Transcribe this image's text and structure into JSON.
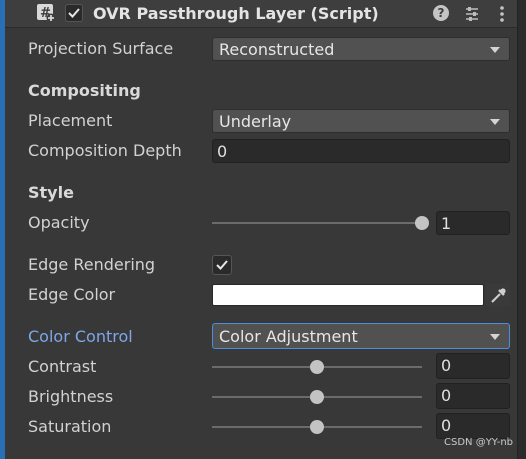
{
  "header": {
    "title": "OVR Passthrough Layer (Script)",
    "enabled": true,
    "help_glyph": "?",
    "icons": [
      "script-icon",
      "checkbox-icon",
      "help-icon",
      "settings-icon",
      "kebab-menu-icon"
    ]
  },
  "fields": {
    "projection_surface": {
      "label": "Projection Surface",
      "value": "Reconstructed"
    },
    "compositing": {
      "heading": "Compositing"
    },
    "placement": {
      "label": "Placement",
      "value": "Underlay"
    },
    "composition_depth": {
      "label": "Composition Depth",
      "value": "0"
    },
    "style": {
      "heading": "Style"
    },
    "opacity": {
      "label": "Opacity",
      "value": "1",
      "slider_level": 1.0
    },
    "edge_rendering": {
      "label": "Edge Rendering",
      "checked": true
    },
    "edge_color": {
      "label": "Edge Color",
      "color": "#ffffff"
    },
    "color_control": {
      "label": "Color Control",
      "value": "Color Adjustment"
    },
    "contrast": {
      "label": "Contrast",
      "value": "0",
      "slider_level": 0.5
    },
    "brightness": {
      "label": "Brightness",
      "value": "0",
      "slider_level": 0.5
    },
    "saturation": {
      "label": "Saturation",
      "value": "0",
      "slider_level": 0.5
    }
  },
  "watermark": "CSDN @YY-nb",
  "colors": {
    "accent": "#4a8fdc",
    "highlight_label": "#7ea7e8",
    "background": "#383838"
  }
}
